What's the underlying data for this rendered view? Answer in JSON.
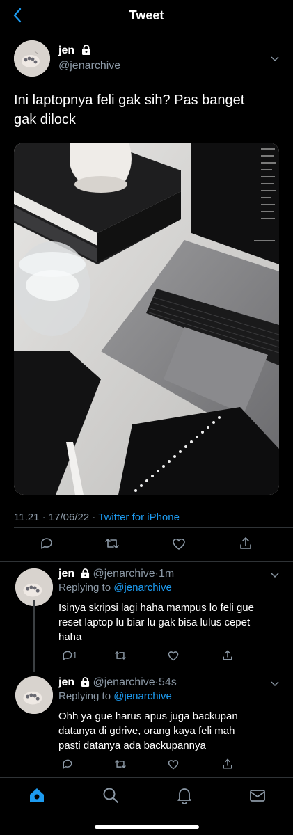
{
  "header": {
    "title": "Tweet"
  },
  "tweet": {
    "author_name": "jen",
    "author_handle": "@jenarchive",
    "text_line1": "Ini laptopnya feli gak sih? Pas banget",
    "text_line2": "gak dilock",
    "time": "11.21",
    "date": "17/06/22",
    "source": "Twitter for iPhone"
  },
  "replies": [
    {
      "author_name": "jen",
      "author_handle": "@jenarchive",
      "age": "1m",
      "replying_label": "Replying to",
      "replying_to": "@jenarchive",
      "line1": "Isinya skripsi lagi haha mampus lo feli gue",
      "line2": "reset laptop lu biar lu gak bisa lulus cepet",
      "line3": "haha",
      "reply_count": "1"
    },
    {
      "author_name": "jen",
      "author_handle": "@jenarchive",
      "age": "54s",
      "replying_label": "Replying to",
      "replying_to": "@jenarchive",
      "line1": "Ohh ya gue harus apus juga backupan",
      "line2": "datanya di gdrive,  orang kaya feli mah",
      "line3": "pasti datanya ada backupannya",
      "reply_count": ""
    }
  ],
  "tabs": [
    "home-icon",
    "search-icon",
    "notifications-icon",
    "messages-icon"
  ],
  "colors": {
    "accent": "#1d9bf0",
    "muted": "#8b98a5",
    "divider": "#2f3336"
  }
}
